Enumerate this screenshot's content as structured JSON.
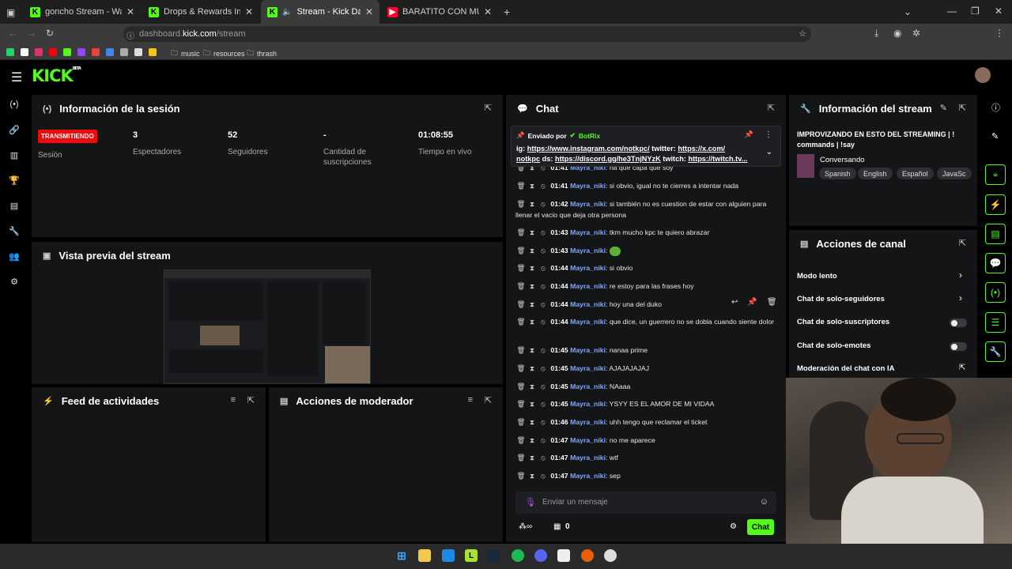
{
  "browser": {
    "tabs": [
      {
        "label": "goncho Stream - Watch Live on Kick",
        "icon": "kick-icon"
      },
      {
        "label": "Drops & Rewards Inventory - Kick",
        "icon": "kick-icon"
      },
      {
        "label": "Stream - Kick Dashboard",
        "icon": "kick-icon"
      },
      {
        "label": "BARATITO CON MUY BUENAS S",
        "icon": "youtube-icon"
      }
    ],
    "url_host": "dashboard.",
    "url_domain": "kick.com",
    "url_path": "/stream",
    "bookmarks": [
      "music",
      "resources",
      "thrash"
    ]
  },
  "session": {
    "title": "Información de la sesión",
    "badge": "TRANSMITIENDO",
    "badge_label": "Sesión",
    "stats": [
      {
        "value": "3",
        "label": "Espectadores"
      },
      {
        "value": "52",
        "label": "Seguidores"
      },
      {
        "value": "-",
        "label": "Cantidad de suscripciones"
      },
      {
        "value": "01:08:55",
        "label": "Tiempo en vivo"
      }
    ]
  },
  "preview": {
    "title": "Vista previa del stream"
  },
  "feed": {
    "title": "Feed de actividades"
  },
  "modactions": {
    "title": "Acciones de moderador"
  },
  "chat": {
    "title": "Chat",
    "pinned_by": "Enviado por",
    "pinned_user": "BotRix",
    "pinned_line1_a": "ig: ",
    "pinned_line1_b": "https://www.instagram.com/notkpc/",
    "pinned_line1_c": " twitter: ",
    "pinned_line1_d": "https://x.com/",
    "pinned_line2_a": "notkpc",
    "pinned_line2_b": " ds: ",
    "pinned_line2_c": "https://discord.gg/he3TnjNYzK",
    "pinned_line2_d": " twitch: ",
    "pinned_line2_e": "https://twitch.tv...",
    "messages": [
      {
        "time": "01:41",
        "user": "Mayra_niki",
        "text": "ña que capa que soy"
      },
      {
        "time": "01:41",
        "user": "Mayra_niki",
        "text": "si obvio, igual no te cierres a intentar nada"
      },
      {
        "time": "01:42",
        "user": "Mayra_niki",
        "text": "si también no es cuestion de estar con alguien para llenar el vacio que deja otra persona"
      },
      {
        "time": "01:43",
        "user": "Mayra_niki",
        "text": "tkm mucho kpc te quiero abrazar"
      },
      {
        "time": "01:43",
        "user": "Mayra_niki",
        "text": ""
      },
      {
        "time": "01:44",
        "user": "Mayra_niki",
        "text": "si obvio"
      },
      {
        "time": "01:44",
        "user": "Mayra_niki",
        "text": "re estoy para las frases hoy"
      },
      {
        "time": "01:44",
        "user": "Mayra_niki",
        "text": "hoy una del duko"
      },
      {
        "time": "01:44",
        "user": "Mayra_niki",
        "text": "que dice, un guerrero no se dobla cuando siente dolor"
      },
      {
        "time": "01:45",
        "user": "Mayra_niki",
        "text": "nanaa prime"
      },
      {
        "time": "01:45",
        "user": "Mayra_niki",
        "text": "AJAJAJAJAJ"
      },
      {
        "time": "01:45",
        "user": "Mayra_niki",
        "text": "NAaaa"
      },
      {
        "time": "01:45",
        "user": "Mayra_niki",
        "text": "YSYY ES EL AMOR DE MI VIDAA"
      },
      {
        "time": "01:46",
        "user": "Mayra_niki",
        "text": "uhh tengo que reclamar el ticket"
      },
      {
        "time": "01:47",
        "user": "Mayra_niki",
        "text": "no me aparece"
      },
      {
        "time": "01:47",
        "user": "Mayra_niki",
        "text": "wtf"
      },
      {
        "time": "01:47",
        "user": "Mayra_niki",
        "text": "sep"
      }
    ],
    "input_placeholder": "Enviar un mensaje",
    "points": "0",
    "send_label": "Chat"
  },
  "stream_info": {
    "title": "Información del stream",
    "stream_title": "IMPROVIZANDO EN ESTO DEL STREAMING | ! commands | !say",
    "category": "Conversando",
    "tags": [
      "Spanish",
      "English",
      "Español",
      "JavaSc"
    ]
  },
  "channel_actions": {
    "title": "Acciones de canal",
    "items": [
      {
        "label": "Modo lento"
      },
      {
        "label": "Chat de solo-seguidores"
      },
      {
        "label": "Chat de solo-suscriptores"
      },
      {
        "label": "Chat de solo-emotes"
      },
      {
        "label": "Moderación del chat con IA"
      }
    ]
  },
  "colors": {
    "accent": "#53fc18",
    "live": "#ec0c0c",
    "username": "#7fa7ff",
    "panel": "#141517"
  }
}
